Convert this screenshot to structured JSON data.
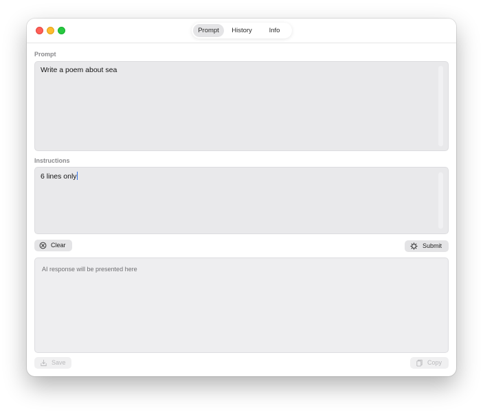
{
  "window": {
    "tabs": [
      {
        "label": "Prompt",
        "selected": true
      },
      {
        "label": "History",
        "selected": false
      },
      {
        "label": "Info",
        "selected": false
      }
    ]
  },
  "prompt": {
    "label": "Prompt",
    "value": "Write a poem about sea"
  },
  "instructions": {
    "label": "Instructions",
    "value": "6 lines only"
  },
  "actions": {
    "clear_label": "Clear",
    "submit_label": "Submit",
    "save_label": "Save",
    "copy_label": "Copy"
  },
  "response": {
    "placeholder": "AI response will be presented here"
  },
  "icons": {
    "clear": "clear-circle-icon",
    "submit": "gear-icon",
    "save": "save-icon",
    "copy": "copy-icon"
  },
  "colors": {
    "close": "#ff5f57",
    "minimize": "#febc2e",
    "maximize": "#28c840",
    "caret": "#2f6fe4"
  }
}
